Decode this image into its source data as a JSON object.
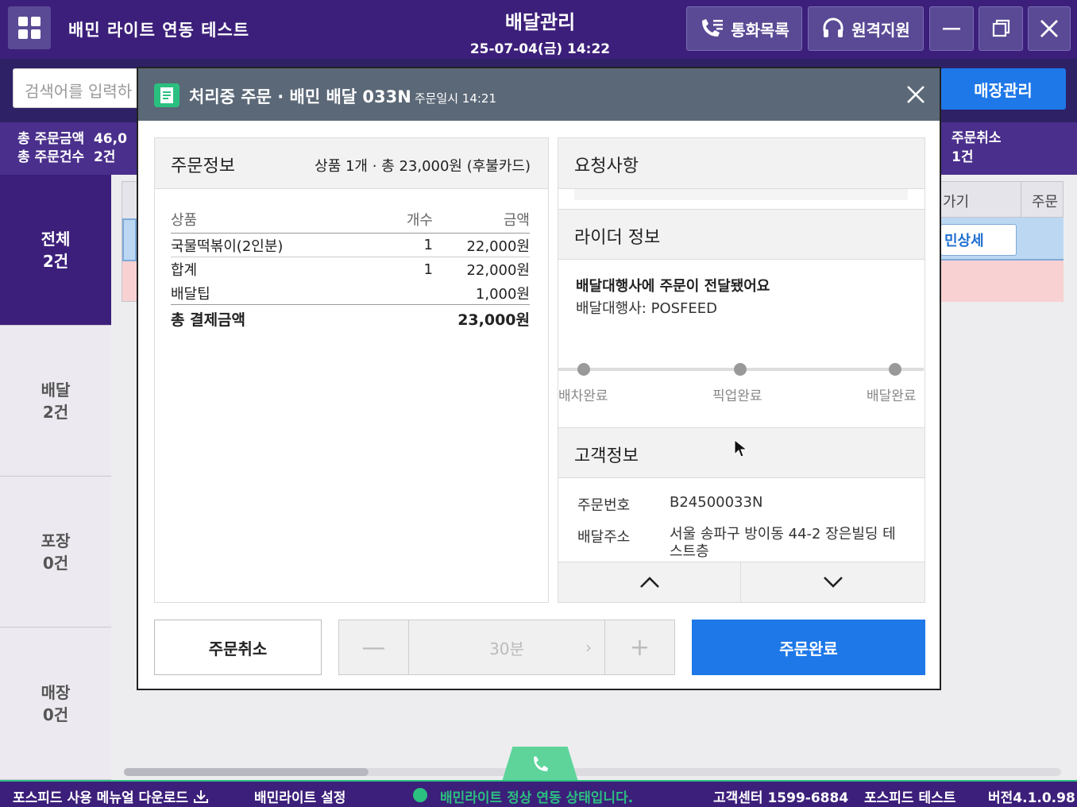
{
  "titlebar": {
    "app_title": "배민 라이트 연동 테스트",
    "center_title": "배달관리",
    "datetime": "25-07-04(금) 14:22",
    "call_log_label": "통화목록",
    "remote_support_label": "원격지원"
  },
  "search": {
    "placeholder": "검색어를 입력하"
  },
  "store_manage_label": "매장관리",
  "summary": {
    "total_amount_label": "총 주문금액",
    "total_amount_value": "46,0",
    "total_count_label": "총 주문건수",
    "total_count_value": "2건",
    "cancel_label": "주문취소",
    "cancel_value": "1건"
  },
  "sidebar": {
    "items": [
      {
        "label": "전체",
        "count": "2건"
      },
      {
        "label": "배달",
        "count": "2건"
      },
      {
        "label": "포장",
        "count": "0건"
      },
      {
        "label": "매장",
        "count": "0건"
      }
    ]
  },
  "background_table": {
    "col_partial_1": "가기",
    "col_partial_2": "주문",
    "detail_button": "민상세"
  },
  "modal": {
    "title": "처리중 주문 · 배민 배달 033N",
    "subtitle": "주문일시 14:21",
    "order_info": {
      "title": "주문정보",
      "meta": "상품 1개 · 총 23,000원 (후불카드)",
      "headers": {
        "item": "상품",
        "qty": "개수",
        "amount": "금액"
      },
      "rows": [
        {
          "item": "국물떡볶이(2인분)",
          "qty": "1",
          "amount": "22,000원"
        },
        {
          "item": "합계",
          "qty": "1",
          "amount": "22,000원"
        },
        {
          "item": "배달팁",
          "qty": "",
          "amount": "1,000원"
        }
      ],
      "total_label": "총 결제금액",
      "total_value": "23,000원"
    },
    "request": {
      "title": "요청사항"
    },
    "rider": {
      "title": "라이더 정보",
      "status": "배달대행사에 주문이 전달됐어요",
      "agency": "배달대행사: POSFEED",
      "stages": [
        "배차완료",
        "픽업완료",
        "배달완료"
      ]
    },
    "customer": {
      "title": "고객정보",
      "order_no_label": "주문번호",
      "order_no": "B24500033N",
      "address_label": "배달주소",
      "address": "서울 송파구 방이동 44-2 장은빌딩 테스트층"
    },
    "actions": {
      "cancel": "주문취소",
      "time": "30분",
      "complete": "주문완료"
    }
  },
  "statusbar": {
    "manual_download": "포스피드 사용 메뉴얼 다운로드",
    "baemin_setting": "배민라이트 설정",
    "status_message": "배민라이트 정상 연동 상태입니다.",
    "customer_center": "고객센터 1599-6884",
    "store_name": "포스피드 테스트",
    "version": "버전4.1.0.98"
  },
  "colors": {
    "brand_purple": "#3c1f7a",
    "accent_blue": "#1e78e8",
    "status_green": "#2bbf80"
  }
}
